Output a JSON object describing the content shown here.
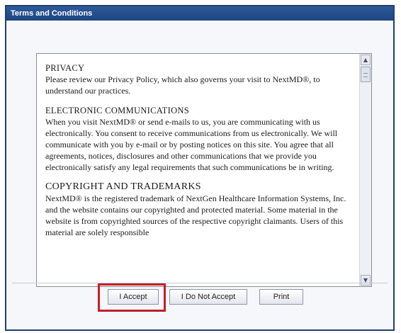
{
  "dialog": {
    "title": "Terms and Conditions"
  },
  "terms": {
    "sections": [
      {
        "heading": "PRIVACY",
        "text": "Please review our Privacy Policy, which also governs your visit to NextMD®, to understand our practices."
      },
      {
        "heading": "ELECTRONIC COMMUNICATIONS",
        "text": "When you visit NextMD® or send e-mails to us, you are communicating with us electronically. You consent to receive communications from us electronically. We will communicate with you by e-mail or by posting notices on this site. You agree that all agreements, notices, disclosures and other communications that we provide you electronically satisfy any legal requirements that such communications be in writing."
      },
      {
        "heading": "COPYRIGHT AND TRADEMARKS",
        "text": "NextMD® is the registered trademark of NextGen Healthcare Information Systems, Inc. and the website contains our copyrighted and protected material. Some material in the website is from copyrighted sources of the respective copyright claimants. Users of this material are solely responsible"
      }
    ]
  },
  "scrollbar": {
    "up_icon": "▲",
    "down_icon": "▼"
  },
  "buttons": {
    "accept": "I Accept",
    "decline": "I Do Not Accept",
    "print": "Print"
  },
  "colors": {
    "titlebar": "#1d4581",
    "highlight": "#c41e2a"
  }
}
